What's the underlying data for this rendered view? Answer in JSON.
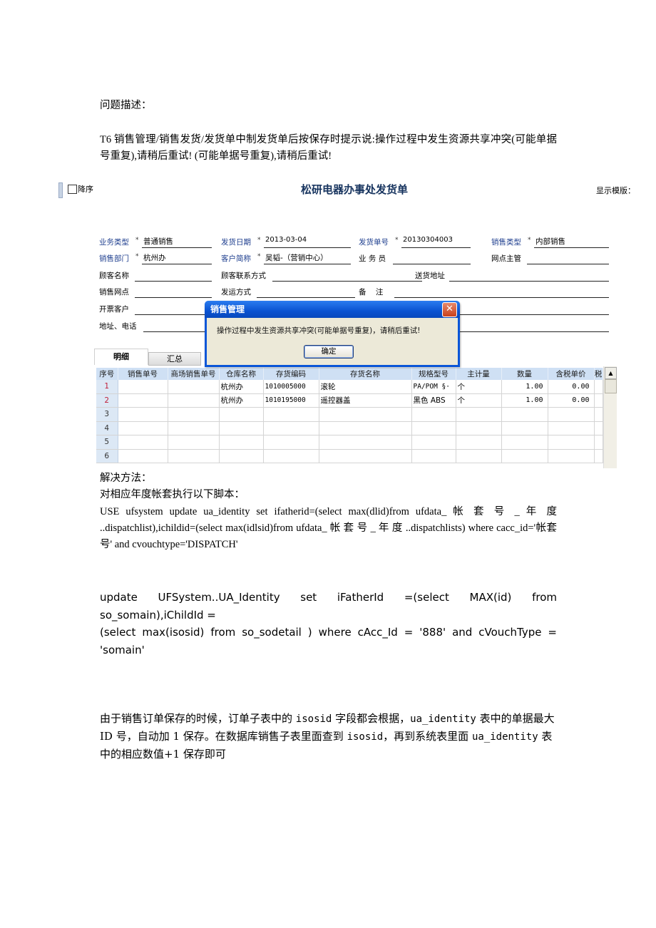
{
  "doc": {
    "problem_heading": "问题描述：",
    "problem_text": "T6  销售管理/销售发货/发货单中制发货单后按保存时提示说:操作过程中发生资源共享冲突(可能单据号重复),请稍后重试! (可能单据号重复),请稍后重试!",
    "solution_heading": "解决方法：",
    "solution_intro": "对相应年度帐套执行以下脚本：",
    "sql1": "USE ufsystem update ua_identity set ifatherid=(select max(dlid)from ufdata_ 帐 套 号 _ 年 度 ..dispatchlist),ichildid=(select max(idlsid)from ufdata_ 帐 套 号 _ 年 度 ..dispatchlists) where cacc_id='帐套号' and cvouchtype='DISPATCH'",
    "sql2_line1": " update   UFSystem..UA_Identity   set   iFatherId   =(select   MAX(id)   from so_somain),iChildId =",
    "sql2_line2": "(select max(isosid) from so_sodetail ) where cAcc_Id = '888' and cVouchType = 'somain'",
    "note_parts": [
      "由于销售订单保存的时候，订单子表中的 ",
      "isosid",
      " 字段都会根据，",
      "ua_identity",
      " 表中的单据最大 ID 号，自动加 1 保存。在数据库销售子表里面查到 ",
      "isosid",
      "，再到系统表里面 ",
      "ua_identity",
      " 表中的相应数值+1 保存即可"
    ]
  },
  "screenshot": {
    "descending_label": "降序",
    "form_title": "松研电器办事处发货单",
    "template_label": "显示模版：",
    "fields": {
      "business_type": {
        "label": "业务类型",
        "value": "普通销售"
      },
      "ship_date": {
        "label": "发货日期",
        "value": "2013-03-04"
      },
      "ship_no": {
        "label": "发货单号",
        "value": "20130304003"
      },
      "sales_type": {
        "label": "销售类型",
        "value": "内部销售"
      },
      "sales_dept": {
        "label": "销售部门",
        "value": "杭州办"
      },
      "customer_short": {
        "label": "客户简称",
        "value": "吴韬-（营销中心）"
      },
      "salesperson": {
        "label": "业 务 员",
        "value": ""
      },
      "outlet_manager": {
        "label": "网点主管",
        "value": ""
      },
      "client_name": {
        "label": "顾客名称",
        "value": ""
      },
      "client_contact": {
        "label": "顾客联系方式",
        "value": ""
      },
      "ship_address": {
        "label": "送货地址",
        "value": ""
      },
      "sales_outlet": {
        "label": "销售网点",
        "value": ""
      },
      "ship_method": {
        "label": "发运方式",
        "value": ""
      },
      "remark": {
        "label": "备    注",
        "value": ""
      },
      "invoice_customer": {
        "label": "开票客户",
        "value": ""
      },
      "address_phone": {
        "label": "地址、电话",
        "value": ""
      }
    },
    "tabs": [
      "明细",
      "汇总"
    ],
    "grid": {
      "columns": [
        "序号",
        "销售单号",
        "商场销售单号",
        "仓库名称",
        "存货编码",
        "存货名称",
        "规格型号",
        "主计量",
        "数量",
        "含税单价",
        "税"
      ],
      "rows": [
        [
          "1",
          "",
          "",
          "杭州办",
          "1010005000",
          "滚轮",
          "PA/POM  §·",
          "个",
          "1.00",
          "0.00",
          ""
        ],
        [
          "2",
          "",
          "",
          "杭州办",
          "1010195000",
          "遥控器盖",
          "黑色 ABS",
          "个",
          "1.00",
          "0.00",
          ""
        ],
        [
          "3",
          "",
          "",
          "",
          "",
          "",
          "",
          "",
          "",
          "",
          ""
        ],
        [
          "4",
          "",
          "",
          "",
          "",
          "",
          "",
          "",
          "",
          "",
          ""
        ],
        [
          "5",
          "",
          "",
          "",
          "",
          "",
          "",
          "",
          "",
          "",
          ""
        ],
        [
          "6",
          "",
          "",
          "",
          "",
          "",
          "",
          "",
          "",
          "",
          ""
        ]
      ]
    },
    "dialog": {
      "title": "销售管理",
      "message": "操作过程中发生资源共享冲突(可能单据号重复)，请稍后重试!",
      "ok_label": "确定",
      "close_glyph": "✕"
    },
    "scroll_up_glyph": "▲"
  }
}
